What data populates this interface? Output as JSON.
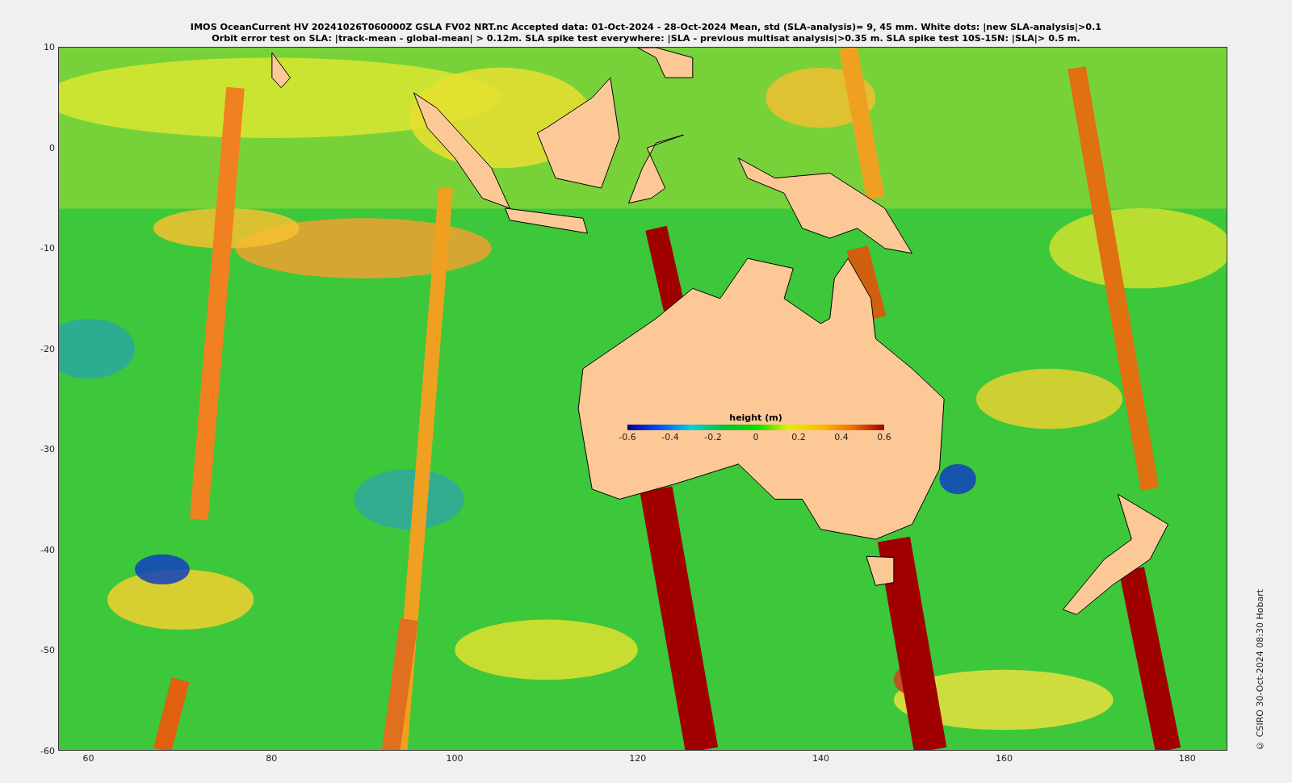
{
  "title_lines": [
    "IMOS OceanCurrent HV 20241026T060000Z GSLA FV02 NRT.nc  Accepted data: 01-Oct-2024 - 28-Oct-2024 Mean, std (SLA-analysis)= 9, 45 mm. White dots: |new SLA-analysis|>0.1",
    "Orbit error test on SLA: |track-mean  - global-mean| > 0.12m.  SLA spike test everywhere: |SLA - previous multisat analysis|>0.35 m. SLA spike test 10S-15N: |SLA|> 0.5 m."
  ],
  "y_ticks": [
    "10",
    "0",
    "-10",
    "-20",
    "-30",
    "-40",
    "-50",
    "-60"
  ],
  "x_ticks": [
    "60",
    "80",
    "100",
    "120",
    "140",
    "160",
    "180"
  ],
  "colorbar": {
    "title": "height (m)",
    "ticks": [
      "-0.6",
      "-0.4",
      "-0.2",
      "0",
      "0.2",
      "0.4",
      "0.6"
    ]
  },
  "credit": "© CSIRO 30-Oct-2024 08:30 Hobart"
}
